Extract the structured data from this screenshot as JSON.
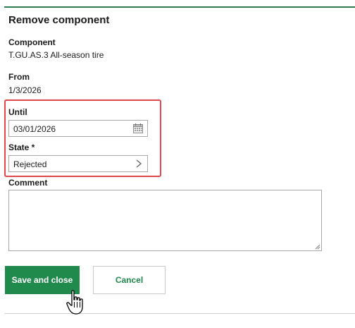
{
  "dialog": {
    "title": "Remove component"
  },
  "component": {
    "label": "Component",
    "value": "T.GU.AS.3 All-season tire"
  },
  "from": {
    "label": "From",
    "value": "1/3/2026"
  },
  "until": {
    "label": "Until",
    "value": "03/01/2026",
    "icon": "calendar-icon"
  },
  "state": {
    "label": "State *",
    "value": "Rejected",
    "icon": "chevron-right-icon"
  },
  "comment": {
    "label": "Comment",
    "value": ""
  },
  "buttons": {
    "save_label": "Save and close",
    "cancel_label": "Cancel"
  },
  "colors": {
    "accent": "#1f8a4c",
    "highlight": "#e0474c",
    "rule": "#2e7d4f"
  }
}
